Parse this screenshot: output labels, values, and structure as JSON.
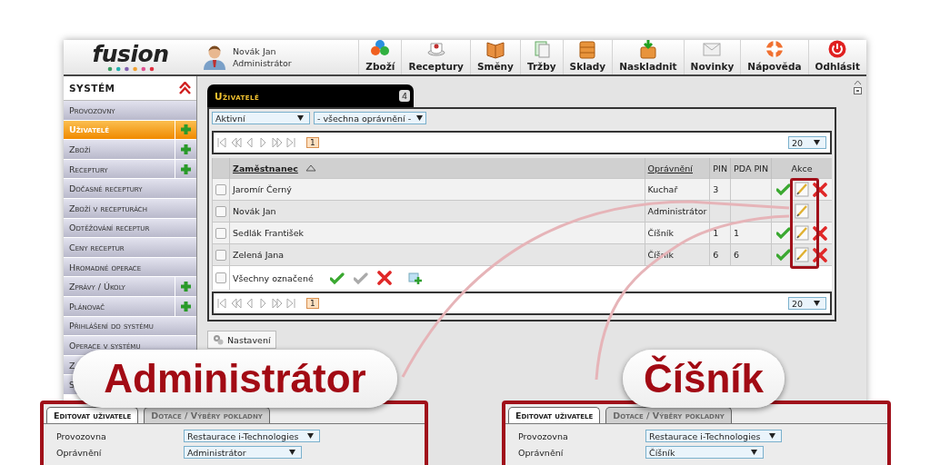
{
  "header": {
    "logo": "fusion",
    "user": {
      "name": "Novák Jan",
      "role": "Administrátor"
    },
    "nav": [
      {
        "label": "Zboží",
        "kind": "goods"
      },
      {
        "label": "Receptury",
        "kind": "recipes"
      },
      {
        "label": "Směny",
        "kind": "shifts"
      },
      {
        "label": "Tržby",
        "kind": "sales"
      },
      {
        "label": "Sklady",
        "kind": "stores"
      },
      {
        "label": "Naskladnit",
        "kind": "stock"
      },
      {
        "label": "Novinky",
        "kind": "news"
      },
      {
        "label": "Nápověda",
        "kind": "help"
      },
      {
        "label": "Odhlásit",
        "kind": "logout"
      }
    ]
  },
  "sidebar": {
    "title": "SYSTÉM",
    "items": [
      {
        "label": "Provozovny",
        "selected": false,
        "add": false
      },
      {
        "label": "Uživatelé",
        "selected": true,
        "add": true
      },
      {
        "label": "Zboží",
        "selected": false,
        "add": true
      },
      {
        "label": "Receptury",
        "selected": false,
        "add": true
      },
      {
        "label": "Dočasné receptury",
        "selected": false,
        "add": false
      },
      {
        "label": "Zboží v recepturách",
        "selected": false,
        "add": false
      },
      {
        "label": "Odtěžování receptur",
        "selected": false,
        "add": false
      },
      {
        "label": "Ceny receptur",
        "selected": false,
        "add": false
      },
      {
        "label": "Hromadné operace",
        "selected": false,
        "add": false
      },
      {
        "label": "Zprávy / Úkoly",
        "selected": false,
        "add": true
      },
      {
        "label": "Plánovač",
        "selected": false,
        "add": true
      },
      {
        "label": "Přihlášení do systému",
        "selected": false,
        "add": false
      },
      {
        "label": "Operace v systému",
        "selected": false,
        "add": false
      },
      {
        "label": "Z",
        "selected": false,
        "add": false
      },
      {
        "label": "S",
        "selected": false,
        "add": false
      }
    ]
  },
  "panel": {
    "title": "Uživatelé",
    "count": "4",
    "filters": [
      "Aktivní",
      "- všechna oprávnění -"
    ],
    "pager_top": {
      "page": "1",
      "per_page": "20"
    },
    "columns": [
      "Zaměstnanec",
      "Oprávnění",
      "PIN",
      "PDA PIN",
      "Akce"
    ],
    "rows": [
      {
        "checked": false,
        "name": "Jaromír Černý",
        "role": "Kuchař",
        "pin": "3",
        "actions": {
          "approve": true,
          "edit": true,
          "delete": true
        }
      },
      {
        "checked": false,
        "name": "Novák Jan",
        "role": "Administrátor",
        "actions": {
          "approve": false,
          "edit": true,
          "delete": false
        }
      },
      {
        "checked": false,
        "name": "Sedlák František",
        "role": "Číšník",
        "pin": "1",
        "pda_pin": "1",
        "actions": {
          "approve": true,
          "edit": true,
          "delete": true
        }
      },
      {
        "checked": false,
        "name": "Zelená Jana",
        "role": "Číšník",
        "pin": "6",
        "pda_pin": "6",
        "actions": {
          "approve": true,
          "edit": true,
          "delete": true
        }
      }
    ],
    "bulk": {
      "label": "Všechny označené",
      "checked": false
    },
    "pager_bottom": {
      "page": "1",
      "per_page": "20"
    },
    "settings_button": "Nastavení"
  },
  "callouts": [
    {
      "label": "Administrátor",
      "tabs": [
        {
          "label": "Editovat uživatele",
          "selected": true
        },
        {
          "label": "Dotace / Výběry pokladny",
          "selected": false
        }
      ],
      "fields": [
        {
          "label": "Provozovna",
          "value": "Restaurace i-Technologies"
        },
        {
          "label": "Oprávnění",
          "value": "Administrátor"
        }
      ]
    },
    {
      "label": "Číšník",
      "tabs": [
        {
          "label": "Editovat uživatele",
          "selected": true
        },
        {
          "label": "Dotace / Výběry pokladny",
          "selected": false
        }
      ],
      "fields": [
        {
          "label": "Provozovna",
          "value": "Restaurace i-Technologies"
        },
        {
          "label": "Oprávnění",
          "value": "Číšník"
        }
      ]
    }
  ]
}
